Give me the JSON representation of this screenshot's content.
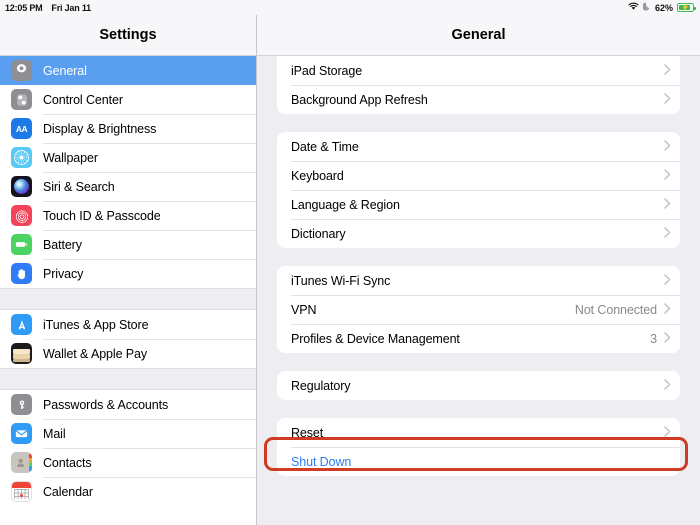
{
  "statusbar": {
    "time": "12:05 PM",
    "date": "Fri Jan 11",
    "wifi_icon": "wifi-icon",
    "dnd_icon": "moon-icon",
    "battery_percent": "62%",
    "battery_icon": "battery-charging-icon",
    "battery_color": "#3aba4e"
  },
  "sidebar": {
    "title": "Settings",
    "selected_color": "#5a9ef0",
    "items": [
      {
        "label": "General",
        "icon": "gear-icon",
        "type": "row",
        "selected": true
      },
      {
        "label": "Control Center",
        "icon": "sliders-icon",
        "type": "row",
        "selected": false
      },
      {
        "label": "Display & Brightness",
        "icon": "aa-text-icon",
        "type": "row",
        "selected": false
      },
      {
        "label": "Wallpaper",
        "icon": "flower-icon",
        "type": "row",
        "selected": false
      },
      {
        "label": "Siri & Search",
        "icon": "siri-orb-icon",
        "type": "row",
        "selected": false
      },
      {
        "label": "Touch ID & Passcode",
        "icon": "fingerprint-icon",
        "type": "row",
        "selected": false
      },
      {
        "label": "Battery",
        "icon": "battery-icon",
        "type": "row",
        "selected": false
      },
      {
        "label": "Privacy",
        "icon": "hand-icon",
        "type": "row",
        "selected": false
      },
      {
        "label": "",
        "icon": "",
        "type": "gap",
        "selected": false
      },
      {
        "label": "iTunes & App Store",
        "icon": "app-store-icon",
        "type": "row",
        "selected": false
      },
      {
        "label": "Wallet & Apple Pay",
        "icon": "wallet-icon",
        "type": "row",
        "selected": false
      },
      {
        "label": "",
        "icon": "",
        "type": "gap",
        "selected": false
      },
      {
        "label": "Passwords & Accounts",
        "icon": "key-icon",
        "type": "row",
        "selected": false
      },
      {
        "label": "Mail",
        "icon": "envelope-icon",
        "type": "row",
        "selected": false
      },
      {
        "label": "Contacts",
        "icon": "contacts-icon",
        "type": "row",
        "selected": false
      },
      {
        "label": "Calendar",
        "icon": "calendar-icon",
        "type": "row",
        "selected": false
      }
    ]
  },
  "detail": {
    "title": "General",
    "groups": [
      {
        "flush_top": true,
        "rows": [
          {
            "label": "iPad Storage",
            "value": "",
            "chevron": true,
            "link": false
          },
          {
            "label": "Background App Refresh",
            "value": "",
            "chevron": true,
            "link": false
          }
        ]
      },
      {
        "flush_top": false,
        "rows": [
          {
            "label": "Date & Time",
            "value": "",
            "chevron": true,
            "link": false
          },
          {
            "label": "Keyboard",
            "value": "",
            "chevron": true,
            "link": false
          },
          {
            "label": "Language & Region",
            "value": "",
            "chevron": true,
            "link": false
          },
          {
            "label": "Dictionary",
            "value": "",
            "chevron": true,
            "link": false
          }
        ]
      },
      {
        "flush_top": false,
        "rows": [
          {
            "label": "iTunes Wi-Fi Sync",
            "value": "",
            "chevron": true,
            "link": false
          },
          {
            "label": "VPN",
            "value": "Not Connected",
            "chevron": true,
            "link": false
          },
          {
            "label": "Profiles & Device Management",
            "value": "3",
            "chevron": true,
            "link": false
          }
        ]
      },
      {
        "flush_top": false,
        "rows": [
          {
            "label": "Regulatory",
            "value": "",
            "chevron": true,
            "link": false
          }
        ]
      },
      {
        "flush_top": false,
        "rows": [
          {
            "label": "Reset",
            "value": "",
            "chevron": true,
            "link": false
          },
          {
            "label": "Shut Down",
            "value": "",
            "chevron": false,
            "link": true
          }
        ]
      }
    ]
  },
  "annotation": {
    "target": "Reset",
    "color": "#cf3b24",
    "shape": "rounded-rectangle"
  }
}
